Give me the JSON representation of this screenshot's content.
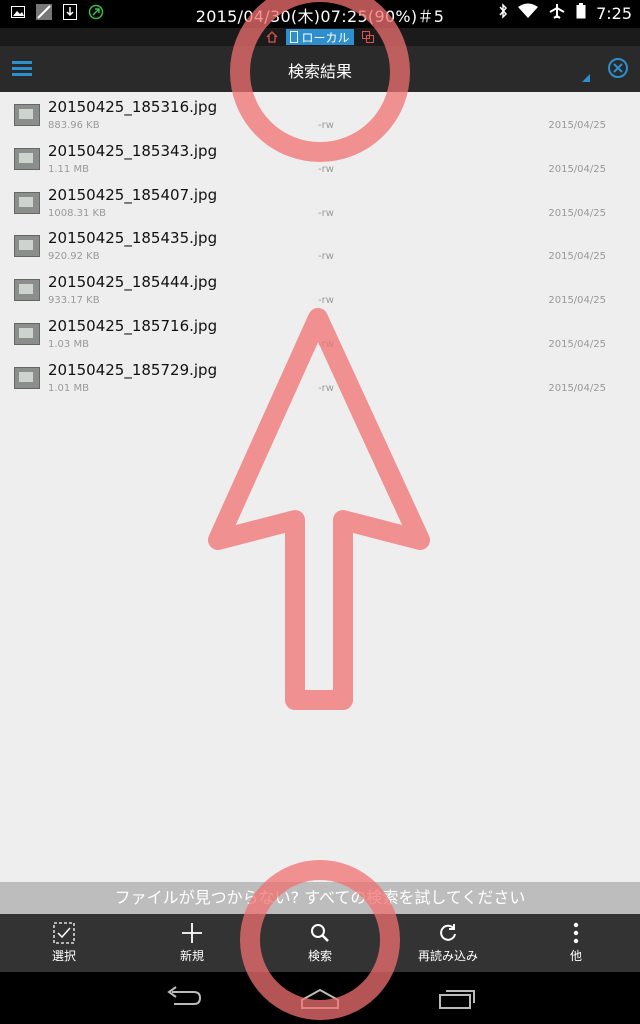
{
  "status_bar": {
    "center_text": "2015/04/30(木)07:25(90%)＃5",
    "time": "7:25",
    "icons": [
      "image-icon",
      "signal-tool-icon",
      "download-icon",
      "green-circle-icon"
    ],
    "right_icons": [
      "bluetooth-icon",
      "wifi-icon",
      "airplane-icon",
      "battery-icon"
    ]
  },
  "location_bar": {
    "label": "ローカル"
  },
  "action_bar": {
    "title": "検索結果"
  },
  "files": [
    {
      "name": "20150425_185316.jpg",
      "size": "883.96 KB",
      "perm": "-rw",
      "date": "2015/04/25"
    },
    {
      "name": "20150425_185343.jpg",
      "size": "1.11 MB",
      "perm": "-rw",
      "date": "2015/04/25"
    },
    {
      "name": "20150425_185407.jpg",
      "size": "1008.31 KB",
      "perm": "-rw",
      "date": "2015/04/25"
    },
    {
      "name": "20150425_185435.jpg",
      "size": "920.92 KB",
      "perm": "-rw",
      "date": "2015/04/25"
    },
    {
      "name": "20150425_185444.jpg",
      "size": "933.17 KB",
      "perm": "-rw",
      "date": "2015/04/25"
    },
    {
      "name": "20150425_185716.jpg",
      "size": "1.03 MB",
      "perm": "-rw",
      "date": "2015/04/25"
    },
    {
      "name": "20150425_185729.jpg",
      "size": "1.01 MB",
      "perm": "-rw",
      "date": "2015/04/25"
    }
  ],
  "hint": "ファイルが見つからない? すべての検索を試してください",
  "toolbar": {
    "select": "選択",
    "new": "新規",
    "search": "検索",
    "reload": "再読み込み",
    "more": "他"
  },
  "colors": {
    "accent": "#2e8fcf",
    "annotation": "#f07070"
  }
}
